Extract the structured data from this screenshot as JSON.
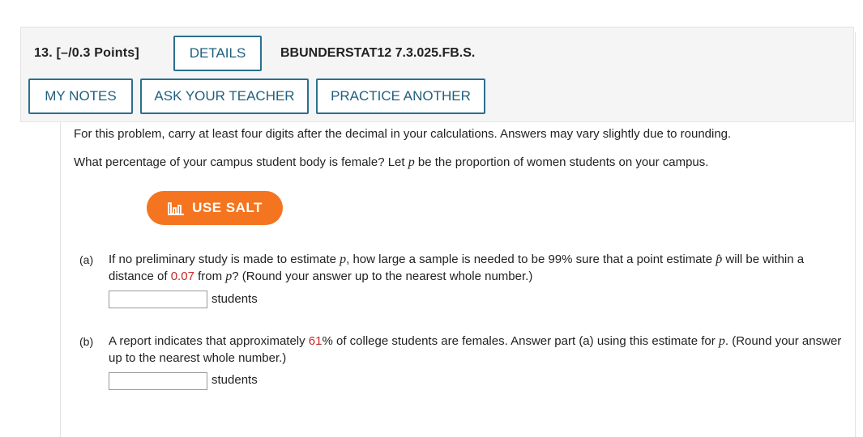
{
  "header": {
    "question_number": "13.",
    "points": "[–/0.3 Points]",
    "details_label": "DETAILS",
    "problem_code": "BBUNDERSTAT12 7.3.025.FB.S.",
    "my_notes_label": "MY NOTES",
    "ask_teacher_label": "ASK YOUR TEACHER",
    "practice_another_label": "PRACTICE ANOTHER"
  },
  "problem": {
    "instruction": "For this problem, carry at least four digits after the decimal in your calculations. Answers may vary slightly due to rounding.",
    "question_pre": "What percentage of your campus student body is female? Let ",
    "question_var": "p",
    "question_post": " be the proportion of women students on your campus."
  },
  "salt": {
    "label": "USE SALT",
    "icon": "salt-chart-icon",
    "color": "#f5741f"
  },
  "part_a": {
    "label": "(a)",
    "text_1": "If no preliminary study is made to estimate ",
    "var_1": "p",
    "text_2": ", how large a sample is needed to be 99% sure that a point estimate ",
    "var_2": "p̂",
    "text_3": " will be within a distance of ",
    "highlight": "0.07",
    "text_4": " from ",
    "var_3": "p",
    "text_5": "? (Round your answer up to the nearest whole number.)",
    "answer_value": "",
    "unit": "students"
  },
  "part_b": {
    "label": "(b)",
    "text_1": "A report indicates that approximately ",
    "highlight": "61",
    "text_2": "% of college students are females. Answer part (a) using this estimate for ",
    "var_1": "p",
    "text_3": ". (Round your answer up to the nearest whole number.)",
    "answer_value": "",
    "unit": "students"
  },
  "colors": {
    "button_border": "#2b6f8f",
    "highlight_red": "#c62828"
  }
}
